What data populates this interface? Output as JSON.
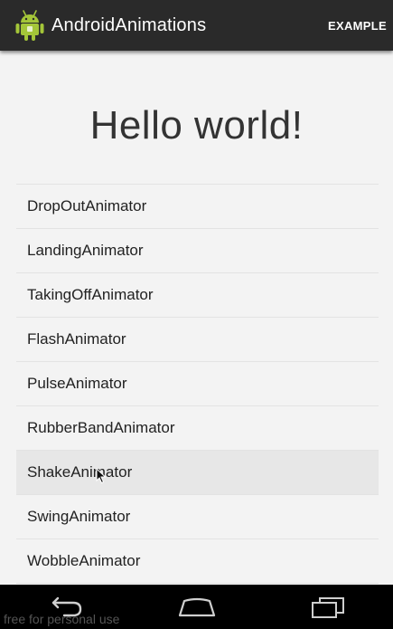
{
  "action_bar": {
    "title": "AndroidAnimations",
    "action_label": "EXAMPLE",
    "app_icon": "android-robot-icon"
  },
  "main": {
    "heading": "Hello world!"
  },
  "animators": [
    {
      "label": "DropOutAnimator"
    },
    {
      "label": "LandingAnimator"
    },
    {
      "label": "TakingOffAnimator"
    },
    {
      "label": "FlashAnimator"
    },
    {
      "label": "PulseAnimator"
    },
    {
      "label": "RubberBandAnimator"
    },
    {
      "label": "ShakeAnimator",
      "pressed": true
    },
    {
      "label": "SwingAnimator"
    },
    {
      "label": "WobbleAnimator"
    }
  ],
  "nav_bar": {
    "icons": [
      "back-icon",
      "home-icon",
      "recent-apps-icon"
    ]
  },
  "watermark": "free for personal use",
  "colors": {
    "action_bar": "#2a2a2a",
    "background": "#f3f3f3",
    "android_green": "#a4c639",
    "pressed_row": "#e7e7e7"
  }
}
